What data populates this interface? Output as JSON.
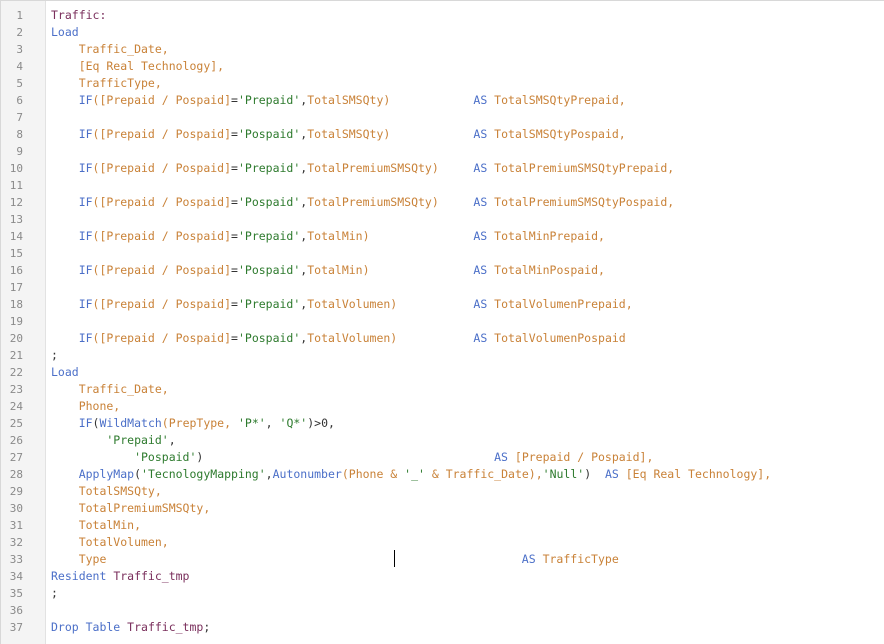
{
  "editor": {
    "line_numbers": [
      "1",
      "2",
      "3",
      "4",
      "5",
      "6",
      "7",
      "8",
      "9",
      "10",
      "11",
      "12",
      "13",
      "14",
      "15",
      "16",
      "17",
      "18",
      "19",
      "20",
      "21",
      "22",
      "23",
      "24",
      "25",
      "26",
      "27",
      "28",
      "29",
      "30",
      "31",
      "32",
      "33",
      "34",
      "35",
      "36",
      "37"
    ],
    "lines": [
      [
        {
          "t": "Traffic:",
          "c": "id"
        }
      ],
      [
        {
          "t": "Load",
          "c": "kw"
        }
      ],
      [
        {
          "t": "    Traffic_Date,",
          "c": "fld"
        }
      ],
      [
        {
          "t": "    [Eq Real Technology],",
          "c": "fld"
        }
      ],
      [
        {
          "t": "    TrafficType,",
          "c": "fld"
        }
      ],
      [
        {
          "t": "    IF",
          "c": "fn"
        },
        {
          "t": "([Prepaid / Pospaid]",
          "c": "fld"
        },
        {
          "t": "=",
          "c": "pn"
        },
        {
          "t": "'Prepaid'",
          "c": "str"
        },
        {
          "t": ",",
          "c": "pn"
        },
        {
          "t": "TotalSMSQty)",
          "c": "fld"
        },
        {
          "t": "            AS ",
          "c": "kw"
        },
        {
          "t": "TotalSMSQtyPrepaid,",
          "c": "fld"
        }
      ],
      [],
      [
        {
          "t": "    IF",
          "c": "fn"
        },
        {
          "t": "([Prepaid / Pospaid]",
          "c": "fld"
        },
        {
          "t": "=",
          "c": "pn"
        },
        {
          "t": "'Pospaid'",
          "c": "str"
        },
        {
          "t": ",",
          "c": "pn"
        },
        {
          "t": "TotalSMSQty)",
          "c": "fld"
        },
        {
          "t": "            AS ",
          "c": "kw"
        },
        {
          "t": "TotalSMSQtyPospaid,",
          "c": "fld"
        }
      ],
      [],
      [
        {
          "t": "    IF",
          "c": "fn"
        },
        {
          "t": "([Prepaid / Pospaid]",
          "c": "fld"
        },
        {
          "t": "=",
          "c": "pn"
        },
        {
          "t": "'Prepaid'",
          "c": "str"
        },
        {
          "t": ",",
          "c": "pn"
        },
        {
          "t": "TotalPremiumSMSQty)",
          "c": "fld"
        },
        {
          "t": "     AS ",
          "c": "kw"
        },
        {
          "t": "TotalPremiumSMSQtyPrepaid,",
          "c": "fld"
        }
      ],
      [],
      [
        {
          "t": "    IF",
          "c": "fn"
        },
        {
          "t": "([Prepaid / Pospaid]",
          "c": "fld"
        },
        {
          "t": "=",
          "c": "pn"
        },
        {
          "t": "'Pospaid'",
          "c": "str"
        },
        {
          "t": ",",
          "c": "pn"
        },
        {
          "t": "TotalPremiumSMSQty)",
          "c": "fld"
        },
        {
          "t": "     AS ",
          "c": "kw"
        },
        {
          "t": "TotalPremiumSMSQtyPospaid,",
          "c": "fld"
        }
      ],
      [],
      [
        {
          "t": "    IF",
          "c": "fn"
        },
        {
          "t": "([Prepaid / Pospaid]",
          "c": "fld"
        },
        {
          "t": "=",
          "c": "pn"
        },
        {
          "t": "'Prepaid'",
          "c": "str"
        },
        {
          "t": ",",
          "c": "pn"
        },
        {
          "t": "TotalMin)",
          "c": "fld"
        },
        {
          "t": "               AS ",
          "c": "kw"
        },
        {
          "t": "TotalMinPrepaid,",
          "c": "fld"
        }
      ],
      [],
      [
        {
          "t": "    IF",
          "c": "fn"
        },
        {
          "t": "([Prepaid / Pospaid]",
          "c": "fld"
        },
        {
          "t": "=",
          "c": "pn"
        },
        {
          "t": "'Pospaid'",
          "c": "str"
        },
        {
          "t": ",",
          "c": "pn"
        },
        {
          "t": "TotalMin)",
          "c": "fld"
        },
        {
          "t": "               AS ",
          "c": "kw"
        },
        {
          "t": "TotalMinPospaid,",
          "c": "fld"
        }
      ],
      [],
      [
        {
          "t": "    IF",
          "c": "fn"
        },
        {
          "t": "([Prepaid / Pospaid]",
          "c": "fld"
        },
        {
          "t": "=",
          "c": "pn"
        },
        {
          "t": "'Prepaid'",
          "c": "str"
        },
        {
          "t": ",",
          "c": "pn"
        },
        {
          "t": "TotalVolumen)",
          "c": "fld"
        },
        {
          "t": "           AS ",
          "c": "kw"
        },
        {
          "t": "TotalVolumenPrepaid,",
          "c": "fld"
        }
      ],
      [],
      [
        {
          "t": "    IF",
          "c": "fn"
        },
        {
          "t": "([Prepaid / Pospaid]",
          "c": "fld"
        },
        {
          "t": "=",
          "c": "pn"
        },
        {
          "t": "'Pospaid'",
          "c": "str"
        },
        {
          "t": ",",
          "c": "pn"
        },
        {
          "t": "TotalVolumen)",
          "c": "fld"
        },
        {
          "t": "           AS ",
          "c": "kw"
        },
        {
          "t": "TotalVolumenPospaid",
          "c": "fld"
        }
      ],
      [
        {
          "t": ";",
          "c": "pn"
        }
      ],
      [
        {
          "t": "Load",
          "c": "kw"
        }
      ],
      [
        {
          "t": "    Traffic_Date,",
          "c": "fld"
        }
      ],
      [
        {
          "t": "    Phone,",
          "c": "fld"
        }
      ],
      [
        {
          "t": "    IF",
          "c": "fn"
        },
        {
          "t": "(",
          "c": "pn"
        },
        {
          "t": "WildMatch",
          "c": "fn"
        },
        {
          "t": "(PrepType, ",
          "c": "fld"
        },
        {
          "t": "'P*'",
          "c": "str"
        },
        {
          "t": ", ",
          "c": "pn"
        },
        {
          "t": "'Q*'",
          "c": "str"
        },
        {
          "t": ")>0,",
          "c": "pn"
        }
      ],
      [
        {
          "t": "        'Prepaid'",
          "c": "str"
        },
        {
          "t": ",",
          "c": "pn"
        }
      ],
      [
        {
          "t": "            'Pospaid'",
          "c": "str"
        },
        {
          "t": ")",
          "c": "pn"
        },
        {
          "t": "                                          AS ",
          "c": "kw"
        },
        {
          "t": "[Prepaid / Pospaid],",
          "c": "fld"
        }
      ],
      [
        {
          "t": "    ApplyMap",
          "c": "fn"
        },
        {
          "t": "(",
          "c": "pn"
        },
        {
          "t": "'TecnologyMapping'",
          "c": "str"
        },
        {
          "t": ",",
          "c": "pn"
        },
        {
          "t": "Autonumber",
          "c": "fn"
        },
        {
          "t": "(Phone & ",
          "c": "fld"
        },
        {
          "t": "'_'",
          "c": "str"
        },
        {
          "t": " & Traffic_Date),",
          "c": "fld"
        },
        {
          "t": "'Null'",
          "c": "str"
        },
        {
          "t": ")  ",
          "c": "pn"
        },
        {
          "t": "AS ",
          "c": "kw"
        },
        {
          "t": "[Eq Real Technology],",
          "c": "fld"
        }
      ],
      [
        {
          "t": "    TotalSMSQty,",
          "c": "fld"
        }
      ],
      [
        {
          "t": "    TotalPremiumSMSQty,",
          "c": "fld"
        }
      ],
      [
        {
          "t": "    TotalMin,",
          "c": "fld"
        }
      ],
      [
        {
          "t": "    TotalVolumen,",
          "c": "fld"
        }
      ],
      [
        {
          "t": "    Type",
          "c": "fld"
        },
        {
          "t": "                                                            AS ",
          "c": "kw"
        },
        {
          "t": "TrafficType",
          "c": "fld"
        }
      ],
      [
        {
          "t": "Resident ",
          "c": "kw"
        },
        {
          "t": "Traffic_tmp",
          "c": "id"
        }
      ],
      [
        {
          "t": ";",
          "c": "pn"
        }
      ],
      [],
      [
        {
          "t": "Drop Table ",
          "c": "kw"
        },
        {
          "t": "Traffic_tmp",
          "c": "id"
        },
        {
          "t": ";",
          "c": "pn"
        }
      ]
    ]
  }
}
